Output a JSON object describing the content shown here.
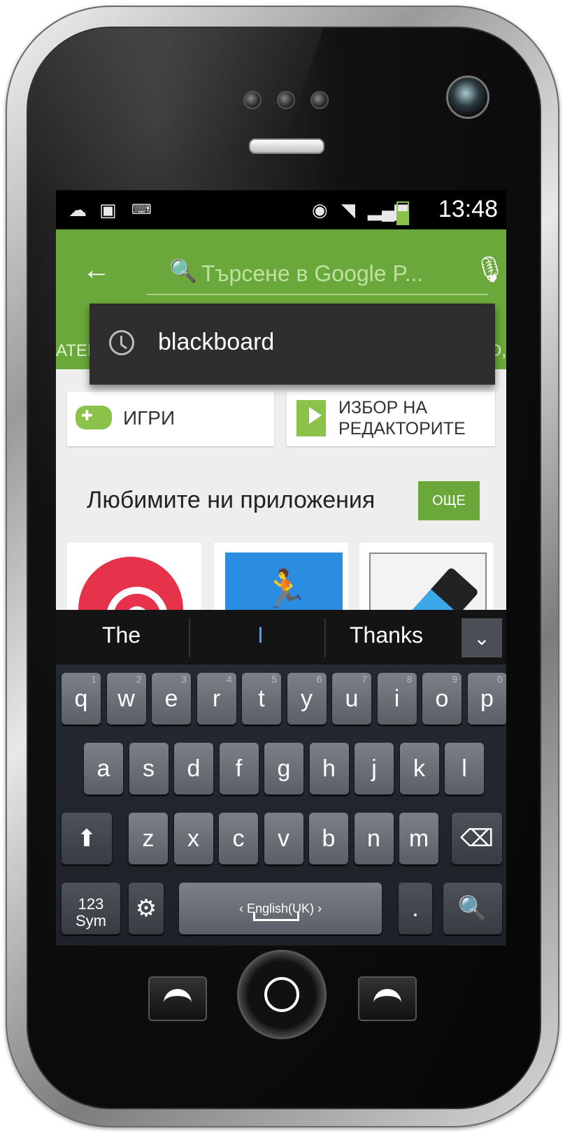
{
  "status_bar": {
    "time": "13:48",
    "icons": [
      "upload-cloud-icon",
      "image-icon",
      "keyboard-icon",
      "eye-icon",
      "wifi-icon",
      "signal-icon",
      "battery-icon"
    ],
    "battery_level": 0.6
  },
  "app_bar": {
    "color": "#6aa83c",
    "search_placeholder": "Търсене в Google P...",
    "tab_left": "ATEI",
    "tab_right": "O,"
  },
  "suggestion": {
    "text": "blackboard"
  },
  "cards": {
    "games_label": "ИГРИ",
    "editors_label": "ИЗБОР НА РЕДАКТОРИТЕ"
  },
  "section": {
    "title": "Любимите ни приложения",
    "more_label": "ОЩЕ"
  },
  "keyboard": {
    "predictions": [
      "The",
      "I",
      "Thanks"
    ],
    "row1": [
      {
        "k": "q",
        "n": "1"
      },
      {
        "k": "w",
        "n": "2"
      },
      {
        "k": "e",
        "n": "3"
      },
      {
        "k": "r",
        "n": "4"
      },
      {
        "k": "t",
        "n": "5"
      },
      {
        "k": "y",
        "n": "6"
      },
      {
        "k": "u",
        "n": "7"
      },
      {
        "k": "i",
        "n": "8"
      },
      {
        "k": "o",
        "n": "9"
      },
      {
        "k": "p",
        "n": "0"
      }
    ],
    "row2": [
      "a",
      "s",
      "d",
      "f",
      "g",
      "h",
      "j",
      "k",
      "l"
    ],
    "row3": [
      "z",
      "x",
      "c",
      "v",
      "b",
      "n",
      "m"
    ],
    "sym_label": "123 Sym",
    "space_label": "English(UK)",
    "period_label": "."
  }
}
